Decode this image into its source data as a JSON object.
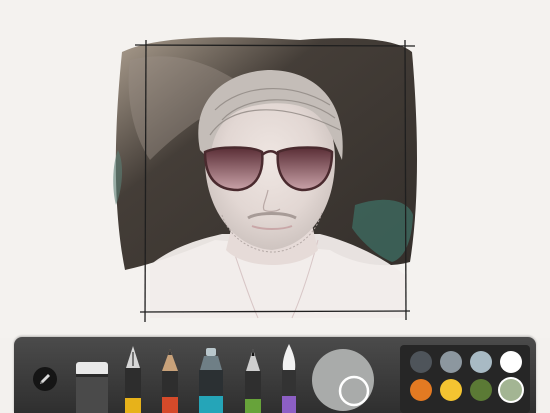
{
  "toolbar": {
    "tools": [
      {
        "name": "pencil-settings",
        "icon": "pencil-icon"
      },
      {
        "name": "eraser",
        "icon": "eraser-icon"
      },
      {
        "name": "fountain-pen",
        "icon": "fountain-pen-icon"
      },
      {
        "name": "pencil",
        "icon": "pencil-tool-icon"
      },
      {
        "name": "marker",
        "icon": "marker-icon"
      },
      {
        "name": "outliner",
        "icon": "outliner-icon"
      },
      {
        "name": "watercolor-brush",
        "icon": "brush-icon"
      },
      {
        "name": "color-mixer",
        "icon": "color-mixer-icon"
      }
    ],
    "palette": {
      "colors": [
        "#4e545a",
        "#8c979f",
        "#a8bac4",
        "#ffffff",
        "#e37a22",
        "#f4c431",
        "#5b7a35",
        "#a3b593"
      ],
      "selected": "#a3b593"
    },
    "mixer_color": "#a9abaa"
  }
}
